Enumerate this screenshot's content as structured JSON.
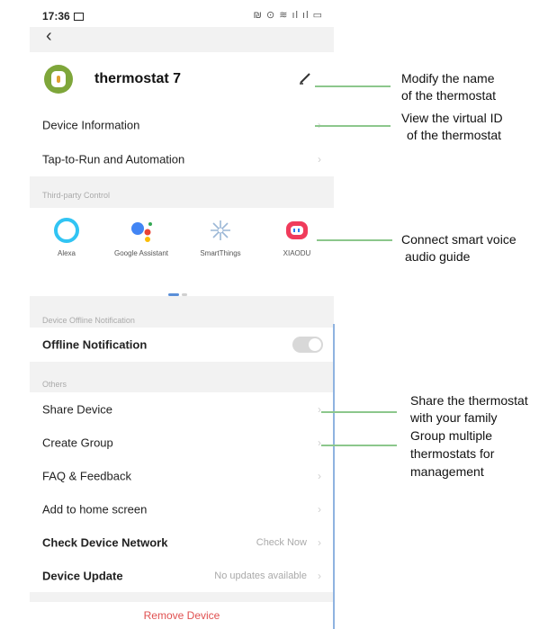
{
  "status_bar": {
    "time": "17:36",
    "icons": "₪ ⊙ ≋ ıl ıl ▭"
  },
  "nav": {
    "back_glyph": "‹"
  },
  "device": {
    "name": "thermostat 7"
  },
  "menu": {
    "device_information": "Device Information",
    "tap_to_run": "Tap-to-Run and Automation",
    "third_party_section": "Third-party Control"
  },
  "third_party": [
    {
      "label": "Alexa",
      "icon": "alexa-icon"
    },
    {
      "label": "Google Assistant",
      "icon": "google-assistant-icon"
    },
    {
      "label": "SmartThings",
      "icon": "smartthings-icon"
    },
    {
      "label": "XIAODU",
      "icon": "xiaodu-icon"
    }
  ],
  "offline": {
    "section": "Device Offline Notification",
    "label": "Offline Notification",
    "toggle_on": false
  },
  "others": {
    "section": "Others",
    "share": "Share Device",
    "create_group": "Create Group",
    "faq": "FAQ & Feedback",
    "home_screen": "Add to home screen",
    "check_network": "Check Device Network",
    "check_network_value": "Check Now",
    "device_update": "Device Update",
    "device_update_value": "No updates available"
  },
  "remove_label": "Remove Device",
  "callouts": {
    "modify_name": [
      "Modify the name",
      "of the thermostat"
    ],
    "virtual_id": [
      "View the virtual ID",
      "of the thermostat"
    ],
    "voice": [
      "Connect smart voice",
      "audio guide"
    ],
    "share": [
      "Share the thermostat",
      "with your family"
    ],
    "group": [
      "Group multiple",
      "thermostats for",
      "management"
    ]
  },
  "colors": {
    "accent_green": "#8cc78c",
    "remove_red": "#e05050",
    "device_green": "#7ea63a"
  }
}
